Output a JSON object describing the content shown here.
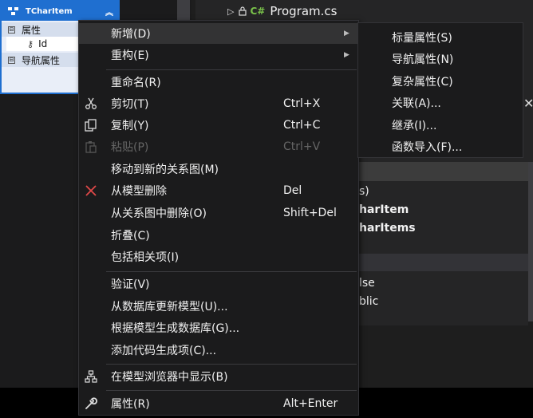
{
  "entity": {
    "title": "TCharItem",
    "section_properties": "属性",
    "property_id": "Id",
    "section_nav": "导航属性",
    "collapse_glyph": "⊟"
  },
  "solution": {
    "file": "Program.cs",
    "cs_badge": "C#"
  },
  "properties_panel": {
    "row1": "s)",
    "row2": "harItem",
    "row3": "harItems",
    "row4": "lse",
    "row5": "blic"
  },
  "menu": {
    "items": [
      {
        "label": "新增(D)",
        "shortcut": "",
        "submenu": true,
        "icon": ""
      },
      {
        "label": "重构(E)",
        "shortcut": "",
        "submenu": true,
        "icon": ""
      },
      {
        "label": "重命名(R)",
        "shortcut": "",
        "icon": ""
      },
      {
        "label": "剪切(T)",
        "shortcut": "Ctrl+X",
        "icon": "scissors-icon"
      },
      {
        "label": "复制(Y)",
        "shortcut": "Ctrl+C",
        "icon": "copy-icon"
      },
      {
        "label": "粘贴(P)",
        "shortcut": "Ctrl+V",
        "icon": "paste-icon",
        "disabled": true
      },
      {
        "label": "移动到新的关系图(M)",
        "shortcut": "",
        "icon": ""
      },
      {
        "label": "从模型删除",
        "shortcut": "Del",
        "icon": "delete-x-icon"
      },
      {
        "label": "从关系图中删除(O)",
        "shortcut": "Shift+Del",
        "icon": ""
      },
      {
        "label": "折叠(C)",
        "shortcut": "",
        "icon": ""
      },
      {
        "label": "包括相关项(I)",
        "shortcut": "",
        "icon": ""
      },
      {
        "label": "验证(V)",
        "shortcut": "",
        "icon": ""
      },
      {
        "label": "从数据库更新模型(U)...",
        "shortcut": "",
        "icon": ""
      },
      {
        "label": "根据模型生成数据库(G)...",
        "shortcut": "",
        "icon": ""
      },
      {
        "label": "添加代码生成项(C)...",
        "shortcut": "",
        "icon": ""
      },
      {
        "label": "在模型浏览器中显示(B)",
        "shortcut": "",
        "icon": "hierarchy-icon"
      },
      {
        "label": "属性(R)",
        "shortcut": "Alt+Enter",
        "icon": "wrench-icon"
      }
    ],
    "submenu_arrow": "▶"
  },
  "submenu": {
    "items": [
      "标量属性(S)",
      "导航属性(N)",
      "复杂属性(C)",
      "关联(A)...",
      "继承(I)...",
      "函数导入(F)..."
    ]
  },
  "colors": {
    "menu_bg": "#1b1b1c",
    "hover_bg": "#333334",
    "entity_accent": "#1f6fd0",
    "delete_icon": "#e04848"
  }
}
